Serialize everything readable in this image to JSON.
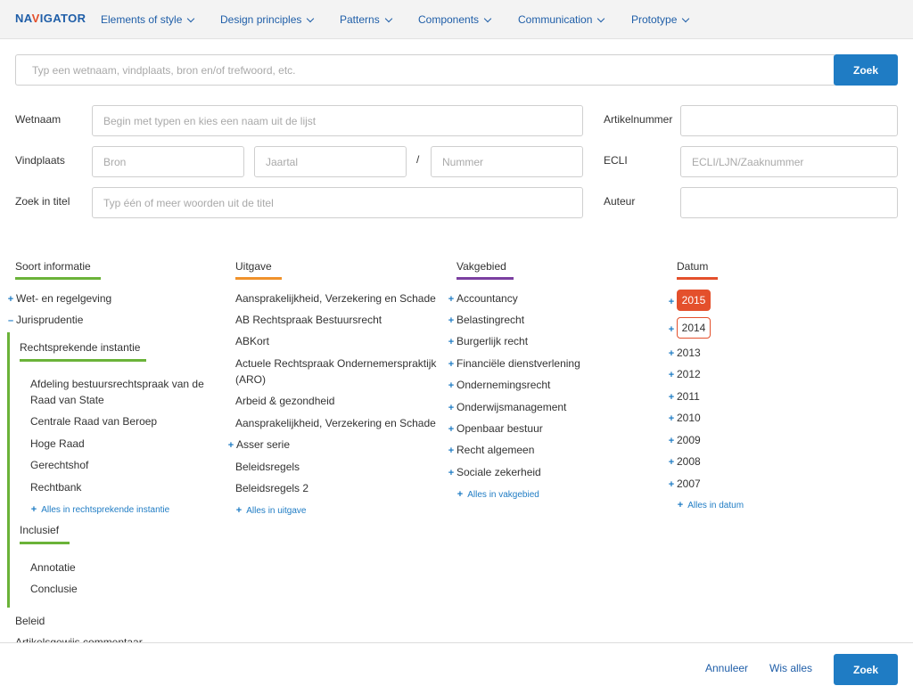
{
  "header": {
    "logo": {
      "prefix": "NA",
      "accent": "V",
      "suffix": "IGATOR"
    },
    "nav": [
      {
        "label": "Elements of style"
      },
      {
        "label": "Design principles"
      },
      {
        "label": "Patterns"
      },
      {
        "label": "Components"
      },
      {
        "label": "Communication"
      },
      {
        "label": "Prototype"
      }
    ]
  },
  "search": {
    "placeholder": "Typ een wetnaam, vindplaats, bron en/of trefwoord, etc.",
    "button_label": "Zoek"
  },
  "form": {
    "wetnaam": {
      "label": "Wetnaam",
      "placeholder": "Begin met typen en kies een naam uit de lijst"
    },
    "vindplaats": {
      "label": "Vindplaats",
      "bron_placeholder": "Bron",
      "jaartal_placeholder": "Jaartal",
      "separator": "/",
      "nummer_placeholder": "Nummer"
    },
    "titel": {
      "label": "Zoek in titel",
      "placeholder": "Typ één of meer woorden uit de titel"
    },
    "artikelnummer": {
      "label": "Artikelnummer",
      "placeholder": ""
    },
    "ecli": {
      "label": "ECLI",
      "placeholder": "ECLI/LJN/Zaaknummer"
    },
    "auteur": {
      "label": "Auteur",
      "placeholder": ""
    }
  },
  "filters": {
    "soort": {
      "title": "Soort informatie",
      "color": "#6bb339",
      "items": [
        "Wet- en regelgeving",
        "Jurisprudentie"
      ],
      "expand_symbols": [
        "+",
        "–"
      ],
      "subgroup1": {
        "title": "Rechtsprekende instantie",
        "items": [
          "Afdeling bestuursrechtspraak van de",
          "Raad van State",
          "Centrale Raad van Beroep",
          "Hoge Raad",
          "Gerechtshof",
          "Rechtbank"
        ],
        "more": "Alles in rechtsprekende instantie"
      },
      "subgroup2": {
        "title": "Inclusief",
        "items": [
          "Annotatie",
          "Conclusie"
        ]
      },
      "after": [
        "Beleid",
        "Artikelsgewijs commentaar"
      ]
    },
    "uitgave": {
      "title": "Uitgave",
      "color": "#f0922b",
      "items": [
        "Aansprakelijkheid, Verzekering en Schade",
        "AB Rechtspraak Bestuursrecht",
        "ABKort",
        "Actuele Rechtspraak Ondernemerspraktijk",
        "(ARO)",
        "Arbeid & gezondheid",
        "Aansprakelijkheid, Verzekering en Schade",
        "Asser serie",
        "Beleidsregels",
        "Beleidsregels 2"
      ],
      "more": "Alles in uitgave"
    },
    "vakgebied": {
      "title": "Vakgebied",
      "color": "#7b3fa0",
      "items": [
        "Accountancy",
        "Belastingrecht",
        "Burgerlijk recht",
        "Financiële dienstverlening",
        "Ondernemingsrecht",
        "Onderwijsmanagement",
        "Openbaar bestuur",
        "Recht algemeen",
        "Sociale zekerheid"
      ],
      "more": "Alles in vakgebied"
    },
    "datum": {
      "title": "Datum",
      "color": "#e4502c",
      "items": [
        "2015",
        "2014",
        "2013",
        "2012",
        "2011",
        "2010",
        "2009",
        "2008",
        "2007"
      ],
      "more": "Alles in datum"
    }
  },
  "footer": {
    "cancel_label": "Annuleer",
    "clear_label": "Wis alles",
    "search_label": "Zoek"
  }
}
